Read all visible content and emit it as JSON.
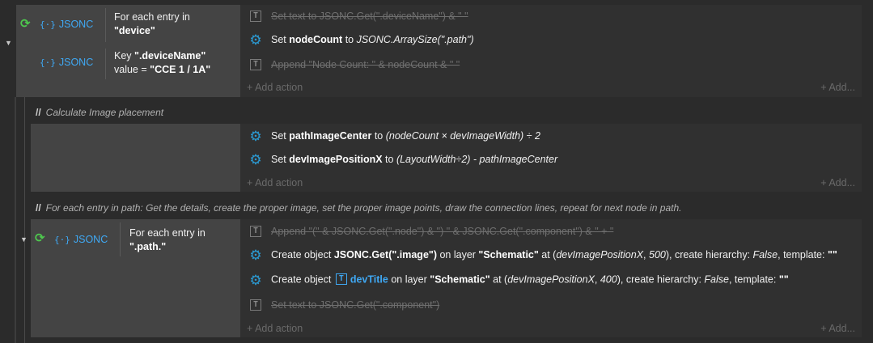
{
  "block1": {
    "condition1": {
      "object_label": "JSONC",
      "text_prefix": "For each entry in",
      "text_bold": "\"device\""
    },
    "condition2": {
      "object_label": "JSONC",
      "line1_prefix": "Key ",
      "line1_bold": "\".deviceName\"",
      "line2_prefix": "value = ",
      "line2_bold": "\"CCE 1 / 1A\""
    },
    "actions": [
      {
        "text": "Set text to JSONC.Get(\".deviceName\") & \" \""
      },
      {
        "prefix": "Set ",
        "bold": "nodeCount",
        "mid": " to ",
        "italic": "JSONC.ArraySize(\".path\")"
      },
      {
        "text": "Append \"Node Count: \" & nodeCount & \" \""
      }
    ],
    "add_action": "+ Add action",
    "add_right": "+ Add..."
  },
  "comment1": {
    "slashes": "//",
    "text": "Calculate Image placement"
  },
  "block2": {
    "actions": [
      {
        "prefix": "Set ",
        "bold": "pathImageCenter",
        "mid": " to ",
        "italic": "(nodeCount × devImageWidth) ÷ 2"
      },
      {
        "prefix": "Set ",
        "bold": "devImagePositionX",
        "mid": " to ",
        "italic": "(LayoutWidth÷2) - pathImageCenter"
      }
    ],
    "add_action": "+ Add action",
    "add_right": "+ Add..."
  },
  "comment2": {
    "slashes": "//",
    "text": "For each entry in path:  Get the details, create the proper image, set the proper image points, draw the connection lines, repeat for next node in path."
  },
  "block3": {
    "condition1": {
      "object_label": "JSONC",
      "text_prefix": "For each entry in",
      "text_bold": "\".path.\""
    },
    "actions": [
      {
        "text": "Append \"(\" & JSONC.Get(\".node\") & \") \" & JSONC.Get(\".component\") & \" + \""
      },
      {
        "p1": "Create object ",
        "b1": "JSONC.Get(\".image\")",
        "p2": " on layer ",
        "b2": "\"Schematic\"",
        "p3": " at (",
        "i1": "devImagePositionX",
        "p4": ", ",
        "i2": "500",
        "p5": "), create hierarchy: ",
        "i3": "False",
        "p6": ", template: ",
        "b3": "\"\""
      },
      {
        "p1": "Create object ",
        "b1": "devTitle",
        "p2": " on layer ",
        "b2": "\"Schematic\"",
        "p3": " at (",
        "i1": "devImagePositionX",
        "p4": ", ",
        "i2": "400",
        "p5": "), create hierarchy: ",
        "i3": "False",
        "p6": ", template: ",
        "b3": "\"\""
      },
      {
        "text": "Set text to JSONC.Get(\".component\")"
      }
    ],
    "add_action": "+ Add action",
    "add_right": "+ Add..."
  },
  "icons": {
    "trigger": "loop-arrow-icon",
    "object": "json-braces-icon",
    "gear": "gear-icon",
    "text": "text-object-icon",
    "collapse": "collapse-arrow-icon"
  },
  "colors": {
    "background": "#2b2b2b",
    "condition_bg": "#444444",
    "action_bg": "#303030",
    "accent_blue": "#3fa9f5",
    "trigger_green": "#4ec94e",
    "gear_blue": "#2b9bd4",
    "disabled_text": "#6f6f6f"
  }
}
